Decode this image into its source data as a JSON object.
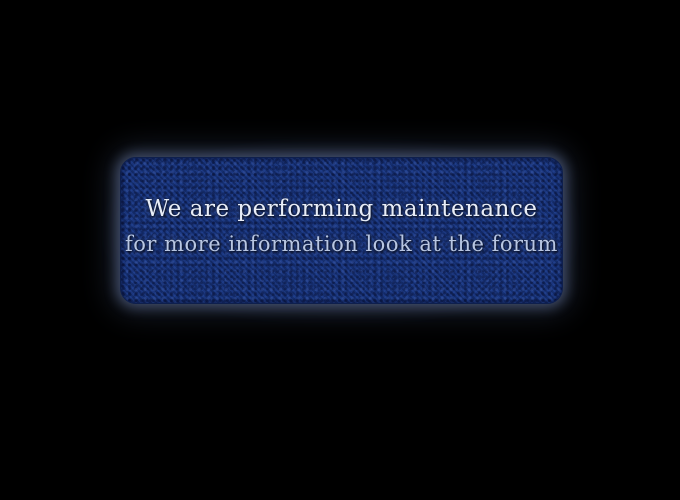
{
  "message": {
    "line1": "We are performing maintenance",
    "line2": "for more information look at the forum"
  },
  "colors": {
    "background": "#000000",
    "panel": "#1b3a86",
    "text_primary": "#e8edf7",
    "text_secondary": "#b8c6e2"
  }
}
